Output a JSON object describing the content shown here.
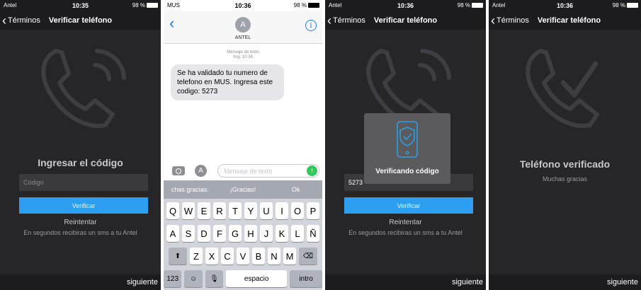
{
  "screen1": {
    "status": {
      "carrier": "Antel",
      "time": "10:35",
      "battery": "98 %"
    },
    "nav": {
      "back_label": "Términos",
      "title": "Verificar teléfono"
    },
    "heading": "Ingresar el código",
    "code_placeholder": "Código",
    "verify_label": "Verificar",
    "retry_label": "Reintentar",
    "retry_note": "En segundos recibiras un sms a tu Antel",
    "next_label": "siguiente"
  },
  "screen2": {
    "status": {
      "carrier": "MUS",
      "time": "10:36",
      "battery": "98 %"
    },
    "contact_initial": "A",
    "contact_name": "ANTEL",
    "info_glyph": "i",
    "meta_type": "Mensaje de texto",
    "meta_time": "hoy, 10:36",
    "message": "Se ha validado tu numero de telefono en MUS.  Ingresa este codigo: 5273",
    "input_placeholder": "Mensaje de texto",
    "app_glyph": "A",
    "suggestions": [
      "chas gracias.",
      "¡Gracias!",
      "Ok"
    ],
    "keyboard": {
      "row1": [
        "Q",
        "W",
        "E",
        "R",
        "T",
        "Y",
        "U",
        "I",
        "O",
        "P"
      ],
      "row2": [
        "A",
        "S",
        "D",
        "F",
        "G",
        "H",
        "J",
        "K",
        "L",
        "Ñ"
      ],
      "row3": [
        "Z",
        "X",
        "C",
        "V",
        "B",
        "N",
        "M"
      ],
      "numbers_label": "123",
      "space_label": "espacio",
      "return_label": "intro"
    }
  },
  "screen3": {
    "status": {
      "carrier": "Antel",
      "time": "10:36",
      "battery": "98 %"
    },
    "nav": {
      "back_label": "Términos",
      "title": "Verificar teléfono"
    },
    "code_value": "5273",
    "overlay_text": "Verificando código",
    "verify_label": "Verificar",
    "retry_label": "Reintentar",
    "retry_note": "En segundos recibiras un sms a tu Antel",
    "next_label": "siguiente"
  },
  "screen4": {
    "status": {
      "carrier": "Antel",
      "time": "10:36",
      "battery": "98 %"
    },
    "nav": {
      "back_label": "Términos",
      "title": "Verificar teléfono"
    },
    "heading": "Teléfono verificado",
    "sub": "Muchas gracias",
    "next_label": "siguiente"
  },
  "colors": {
    "accent": "#2d9ef0",
    "ios_blue": "#1a7cf5",
    "send_green": "#34c759",
    "overlay_icon": "#2b9fe8"
  }
}
